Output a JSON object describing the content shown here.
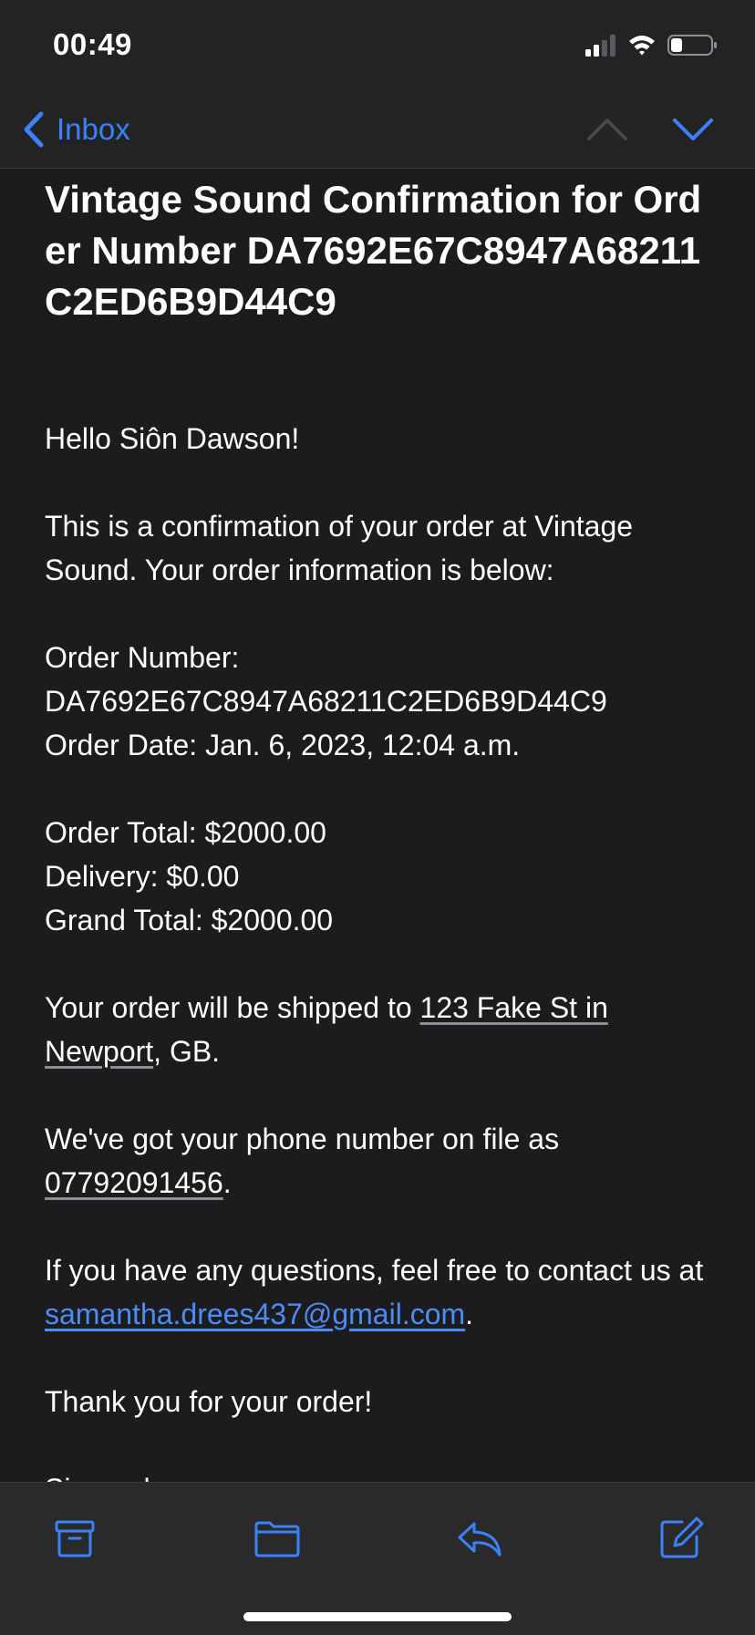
{
  "status_bar": {
    "time": "00:49",
    "icons": [
      "cellular-signal-icon",
      "wifi-icon",
      "battery-icon"
    ]
  },
  "nav": {
    "back_label": "Inbox",
    "icons": [
      "chevron-left-icon",
      "chevron-up-icon",
      "chevron-down-icon"
    ]
  },
  "email": {
    "subject": "Vintage Sound Confirmation for Order Number DA7692E67C8947A68211C2ED6B9D44C9",
    "greeting": "Hello Siôn Dawson!",
    "intro": "This is a confirmation of your order at Vintage Sound. Your order information is below:",
    "order_number_label": "Order Number:",
    "order_number": "DA7692E67C8947A68211C2ED6B9D44C9",
    "order_date": "Order Date: Jan. 6, 2023, 12:04 a.m.",
    "order_total": "Order Total: $2000.00",
    "delivery": "Delivery: $0.00",
    "grand_total": "Grand Total: $2000.00",
    "shipping_prefix": "Your order will be shipped to ",
    "shipping_address": "123 Fake St in Newport",
    "shipping_suffix": ", GB.",
    "phone_prefix": "We've got your phone number on file as ",
    "phone_number": "07792091456",
    "phone_suffix": ".",
    "contact_prefix": "If you have any questions, feel free to contact us at ",
    "contact_email": "samantha.drees437@gmail.com",
    "contact_suffix": ".",
    "thanks": "Thank you for your order!",
    "signoff": "Sincerely,"
  },
  "toolbar": {
    "icons": [
      "archive-icon",
      "folder-icon",
      "reply-icon",
      "compose-icon"
    ]
  },
  "colors": {
    "accent": "#3b82f6",
    "background": "#1c1c1e",
    "bar_background": "#232325",
    "toolbar_background": "#2a2a2c"
  }
}
